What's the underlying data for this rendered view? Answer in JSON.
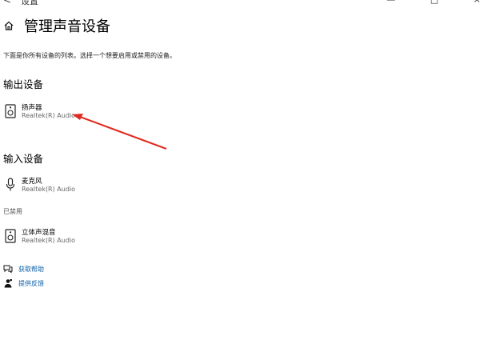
{
  "window": {
    "back_glyph": "<",
    "title": "设置",
    "controls": "— □ ×"
  },
  "page": {
    "title": "管理声音设备",
    "description": "下面是你所有设备的列表。选择一个想要启用或禁用的设备。"
  },
  "output_section": {
    "heading": "输出设备",
    "devices": [
      {
        "name": "扬声器",
        "driver": "Realtek(R) Audio",
        "icon": "speaker-icon"
      }
    ]
  },
  "input_section": {
    "heading": "输入设备",
    "devices": [
      {
        "name": "麦克风",
        "driver": "Realtek(R) Audio",
        "icon": "microphone-icon"
      }
    ]
  },
  "disabled_section": {
    "label": "已禁用",
    "devices": [
      {
        "name": "立体声混音",
        "driver": "Realtek(R) Audio",
        "icon": "speaker-icon"
      }
    ]
  },
  "links": {
    "get_help": {
      "label": "获取帮助",
      "icon": "help-chat-icon"
    },
    "feedback": {
      "label": "提供反馈",
      "icon": "feedback-icon"
    }
  },
  "colors": {
    "link": "#0a5fa8",
    "annotation_arrow": "#e02b20"
  }
}
